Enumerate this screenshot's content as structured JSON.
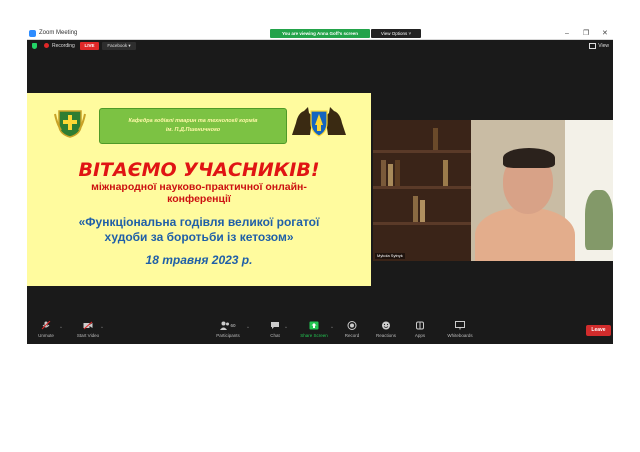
{
  "window": {
    "app_title": "Zoom Meeting",
    "share_banner": "You are viewing Anna Goff's screen",
    "view_options": "View Options ˅",
    "minimize": "–",
    "restore": "❐",
    "close": "✕"
  },
  "status": {
    "recording": "Recording",
    "live": "LIVE",
    "facebook": "Facebook ▾",
    "view": "View"
  },
  "slide": {
    "dept_line1": "Кафедра годівлі тварин та технології кормів",
    "dept_line2": "ім. П.Д.Пшеничного",
    "title": "ВІТАЄМО УЧАСНИКІВ!",
    "subtitle_line1": "міжнародної науково-практичної онлайн-",
    "subtitle_line2": "конференції",
    "topic_line1": "«Функціональна годівля великої рогатої",
    "topic_line2": "худоби за боротьби із кетозом»",
    "date": "18 травня 2023 р."
  },
  "video": {
    "participant_name": "Mykola Sytnyk"
  },
  "toolbar": {
    "unmute": "Unmute",
    "start_video": "Start Video",
    "participants": "Participants",
    "participants_count": "60",
    "chat": "Chat",
    "share_screen": "Share Screen",
    "record": "Record",
    "reactions": "Reactions",
    "apps": "Apps",
    "whiteboards": "Whiteboards",
    "leave": "Leave"
  },
  "colors": {
    "share_green": "#23a34a",
    "live_red": "#e02828",
    "slide_bg": "#fffb9e",
    "title_red": "#e01414",
    "topic_blue": "#1f5fa8",
    "leave_red": "#d12c2c"
  }
}
